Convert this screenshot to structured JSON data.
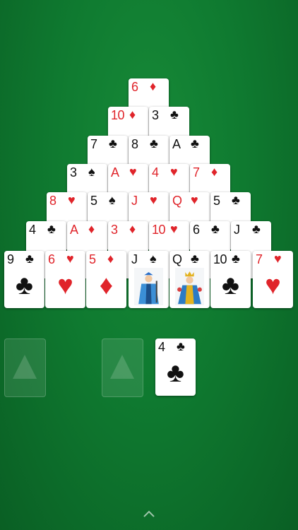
{
  "pyramid": {
    "row1": [
      {
        "rank": "6",
        "suit": "♦",
        "color": "red"
      }
    ],
    "row2": [
      {
        "rank": "10",
        "suit": "♦",
        "color": "red"
      },
      {
        "rank": "3",
        "suit": "♣",
        "color": "black"
      }
    ],
    "row3": [
      {
        "rank": "7",
        "suit": "♣",
        "color": "black"
      },
      {
        "rank": "8",
        "suit": "♣",
        "color": "black"
      },
      {
        "rank": "A",
        "suit": "♣",
        "color": "black"
      }
    ],
    "row4": [
      {
        "rank": "3",
        "suit": "♠",
        "color": "black"
      },
      {
        "rank": "A",
        "suit": "♥",
        "color": "red"
      },
      {
        "rank": "4",
        "suit": "♥",
        "color": "red"
      },
      {
        "rank": "7",
        "suit": "♦",
        "color": "red"
      }
    ],
    "row5": [
      {
        "rank": "8",
        "suit": "♥",
        "color": "red"
      },
      {
        "rank": "5",
        "suit": "♠",
        "color": "black"
      },
      {
        "rank": "J",
        "suit": "♥",
        "color": "red"
      },
      {
        "rank": "Q",
        "suit": "♥",
        "color": "red"
      },
      {
        "rank": "5",
        "suit": "♣",
        "color": "black"
      }
    ],
    "row6": [
      {
        "rank": "4",
        "suit": "♣",
        "color": "black"
      },
      {
        "rank": "A",
        "suit": "♦",
        "color": "red"
      },
      {
        "rank": "3",
        "suit": "♦",
        "color": "red"
      },
      {
        "rank": "10",
        "suit": "♥",
        "color": "red"
      },
      {
        "rank": "6",
        "suit": "♣",
        "color": "black"
      },
      {
        "rank": "J",
        "suit": "♣",
        "color": "black"
      }
    ],
    "row7": [
      {
        "rank": "9",
        "suit": "♣",
        "color": "black"
      },
      {
        "rank": "6",
        "suit": "♥",
        "color": "red"
      },
      {
        "rank": "5",
        "suit": "♦",
        "color": "red"
      },
      {
        "rank": "J",
        "suit": "♠",
        "color": "black"
      },
      {
        "rank": "Q",
        "suit": "♣",
        "color": "black"
      },
      {
        "rank": "10",
        "suit": "♣",
        "color": "black"
      },
      {
        "rank": "7",
        "suit": "♥",
        "color": "red"
      }
    ]
  },
  "waste": {
    "rank": "4",
    "suit": "♣",
    "color": "black"
  },
  "colors": {
    "felt": "#0f7a30",
    "red": "#e0242a",
    "black": "#111111"
  },
  "icons": {
    "stock_slot": "empty-stock-slot",
    "bottom_toggle": "chevron-up-icon"
  }
}
